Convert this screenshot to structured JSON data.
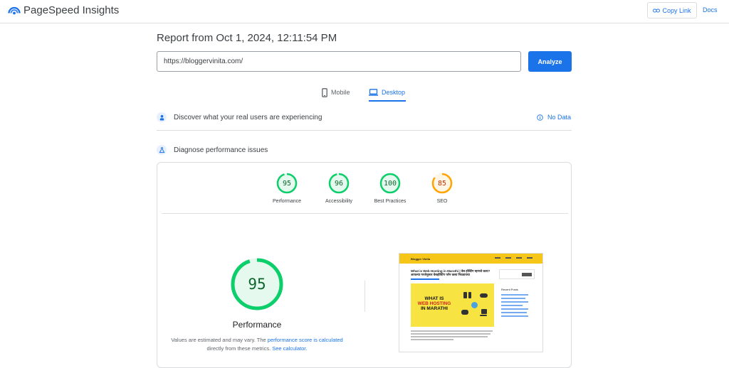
{
  "header": {
    "app_name": "PageSpeed Insights",
    "copy_link": "Copy Link",
    "docs": "Docs"
  },
  "report": {
    "title": "Report from Oct 1, 2024, 12:11:54 PM",
    "url_value": "https://bloggervinita.com/",
    "analyze_label": "Analyze"
  },
  "tabs": [
    {
      "label": "Mobile",
      "active": false
    },
    {
      "label": "Desktop",
      "active": true
    }
  ],
  "sections": {
    "real_users": "Discover what your real users are experiencing",
    "no_data": "No Data",
    "diagnose": "Diagnose performance issues"
  },
  "scores": [
    {
      "label": "Performance",
      "value": "95",
      "color": "#0cce6b"
    },
    {
      "label": "Accessibility",
      "value": "96",
      "color": "#0cce6b"
    },
    {
      "label": "Best Practices",
      "value": "100",
      "color": "#0cce6b"
    },
    {
      "label": "SEO",
      "value": "85",
      "color": "#ffa400"
    }
  ],
  "performance": {
    "score": "95",
    "title": "Performance",
    "note_prefix": "Values are estimated and may vary. The ",
    "note_link1": "performance score is calculated",
    "note_middle": " directly from these metrics. ",
    "note_link2": "See calculator."
  },
  "screenshot": {
    "site_name": "Blogger Vinita",
    "post_title": "What is Web Hosting in Marathi | वेब होस्टिंग म्हणजे काय? आपल्या गरजेनुसार वेबहोस्टिंग प्लॅन कसा निवडायचा",
    "hero_line1": "WHAT IS",
    "hero_line2": "WEB HOSTING",
    "hero_line3": "IN MARATHI",
    "sidebar_heading": "Recent Posts"
  },
  "colors": {
    "accent": "#1a73e8",
    "pass": "#0cce6b",
    "average": "#ffa400"
  }
}
